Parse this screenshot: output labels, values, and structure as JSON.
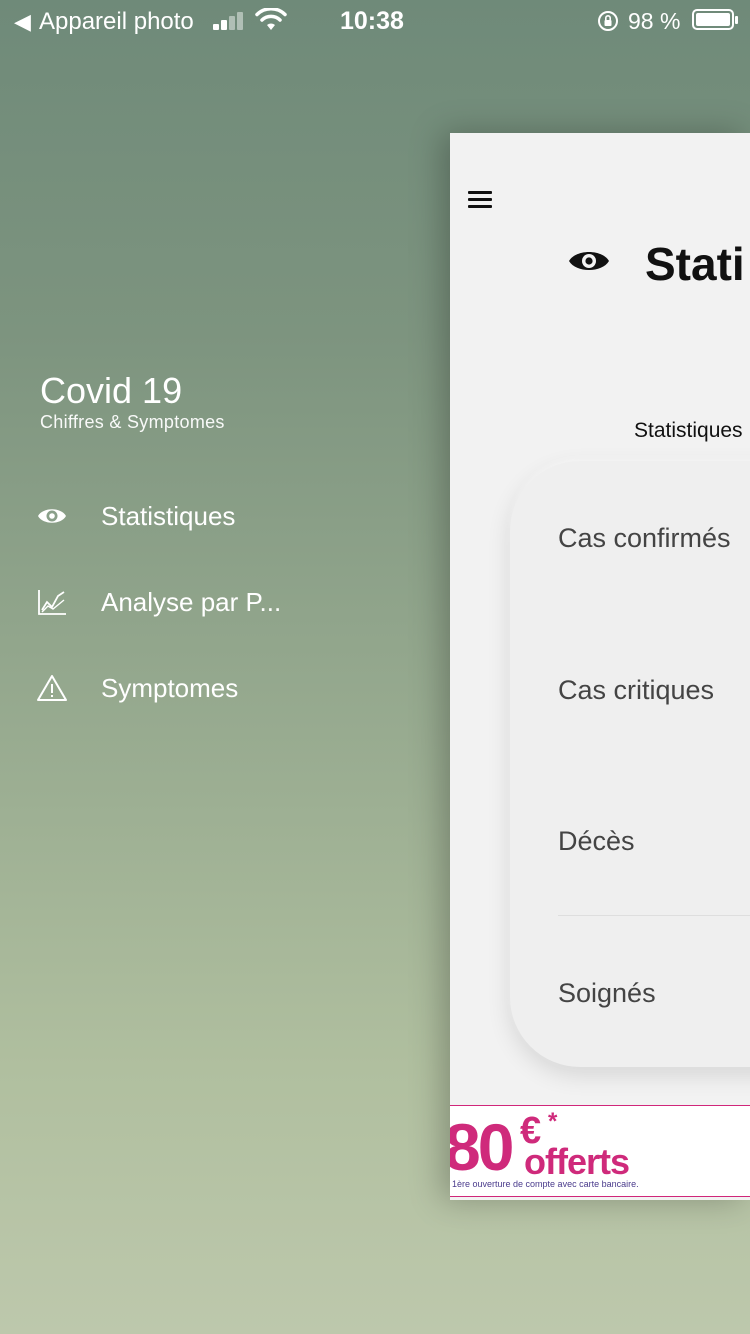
{
  "status_bar": {
    "back_app": "Appareil photo",
    "time": "10:38",
    "battery_pct": "98 %",
    "battery_level": 0.98,
    "signal_bars": 2
  },
  "drawer": {
    "title": "Covid 19",
    "subtitle": "Chiffres & Symptomes",
    "items": [
      {
        "label": "Statistiques",
        "icon": "eye-icon"
      },
      {
        "label": "Analyse par P...",
        "icon": "chart-icon"
      },
      {
        "label": "Symptomes",
        "icon": "warning-icon"
      }
    ]
  },
  "main": {
    "title": "Stati",
    "section_label": "Statistiques",
    "stats": [
      "Cas confirmés",
      "Cas critiques",
      "Décès",
      "Soignés"
    ]
  },
  "ad": {
    "amount": "80",
    "currency": "€",
    "star": "*",
    "offer": "offerts",
    "fine_print": "1ère ouverture de compte avec carte bancaire."
  },
  "colors": {
    "ad_accent": "#cf2a7b",
    "panel_bg": "#f2f2f2"
  }
}
